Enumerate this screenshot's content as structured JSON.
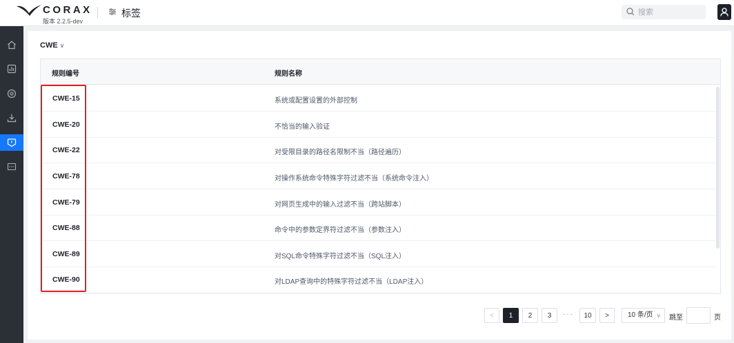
{
  "header": {
    "brand": "CORAX",
    "version": "版本 2.2.5-dev",
    "page_title": "标签",
    "search_placeholder": "搜索"
  },
  "sidebar": {
    "items": [
      {
        "icon": "home-icon",
        "active": false
      },
      {
        "icon": "chart-icon",
        "active": false
      },
      {
        "icon": "settings-icon",
        "active": false
      },
      {
        "icon": "download-icon",
        "active": false
      },
      {
        "icon": "tag-icon",
        "active": true
      },
      {
        "icon": "rule-icon",
        "active": false
      }
    ]
  },
  "filter": {
    "label": "CWE",
    "chevron": "∨"
  },
  "table": {
    "columns": [
      "规则编号",
      "规则名称"
    ],
    "rows": [
      {
        "id": "CWE-15",
        "name": "系统或配置设置的外部控制"
      },
      {
        "id": "CWE-20",
        "name": "不恰当的输入验证"
      },
      {
        "id": "CWE-22",
        "name": "对受限目录的路径名限制不当（路径遍历）"
      },
      {
        "id": "CWE-78",
        "name": "对操作系统命令特殊字符过滤不当（系统命令注入）"
      },
      {
        "id": "CWE-79",
        "name": "对网页生成中的输入过滤不当（跨站脚本）"
      },
      {
        "id": "CWE-88",
        "name": "命令中的参数定界符过滤不当（参数注入）"
      },
      {
        "id": "CWE-89",
        "name": "对SQL命令特殊字符过滤不当（SQL注入）"
      },
      {
        "id": "CWE-90",
        "name": "对LDAP查询中的特殊字符过滤不当（LDAP注入）"
      }
    ]
  },
  "pagination": {
    "prev": "<",
    "pages": [
      "1",
      "2",
      "3"
    ],
    "ellipsis": "···",
    "last_page": "10",
    "next": ">",
    "current": "1",
    "page_size": "10 条/页",
    "page_size_chevron": "∨",
    "jump_label": "跳至",
    "page_suffix": "页"
  },
  "colors": {
    "sidebar_bg": "#2b2f36",
    "sidebar_active": "#1677ff",
    "highlight_box": "#e02020",
    "active_page": "#1d2129"
  }
}
